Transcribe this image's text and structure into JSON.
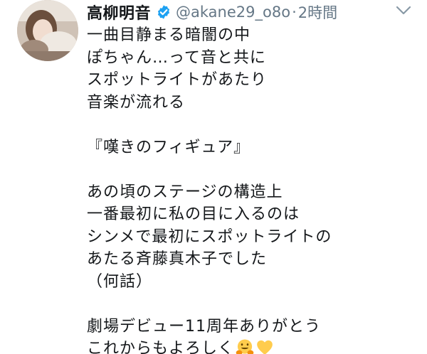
{
  "tweet": {
    "display_name": "高柳明音",
    "handle": "@akane29_o8o",
    "separator": "·",
    "time": "2時間",
    "body_lines": [
      "一曲目静まる暗闇の中",
      "ぽちゃん…って音と共に",
      "スポットライトがあたり",
      "音楽が流れる",
      "",
      "『嘆きのフィギュア』",
      "",
      "あの頃のステージの構造上",
      "一番最初に私の目に入るのは",
      "シンメで最初にスポットライトの",
      "あたる斉藤真木子でした",
      "（何話）",
      "",
      "劇場デビュー11周年ありがとう",
      "これからもよろしく"
    ],
    "trailing_emojis": [
      "hugging-face",
      "yellow-heart"
    ]
  },
  "colors": {
    "verified_blue": "#1da1f2",
    "muted_gray": "#657786",
    "text": "#14171a",
    "heart_yellow": "#ffcc4d",
    "face_yellow": "#ffcc4d"
  },
  "icons": {
    "verified": "verified-badge-icon",
    "menu": "chevron-down-icon"
  }
}
